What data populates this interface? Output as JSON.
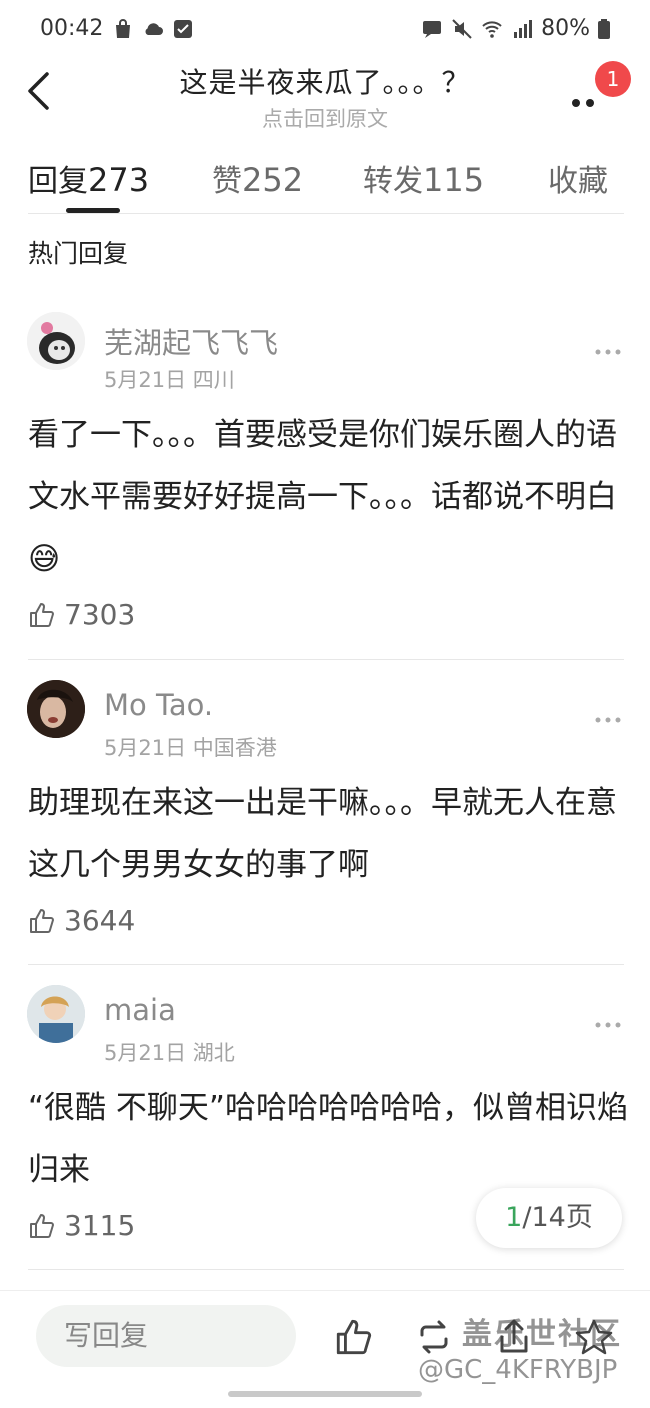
{
  "status_bar": {
    "time": "00:42",
    "battery": "80%"
  },
  "nav": {
    "title": "这是半夜来瓜了。。。？",
    "subtitle": "点击回到原文",
    "badge": "1"
  },
  "tabs": [
    {
      "label": "回复",
      "count": "273"
    },
    {
      "label": "赞",
      "count": "252"
    },
    {
      "label": "转发",
      "count": "115"
    },
    {
      "label": "收藏",
      "count": ""
    }
  ],
  "section_title": "热门回复",
  "comments": [
    {
      "name": "芜湖起飞飞飞",
      "meta": "5月21日 四川",
      "body": "看了一下。。。首要感受是你们娱乐圈人的语文水平需要好好提高一下。。。话都说不明白😅",
      "likes": "7303"
    },
    {
      "name": "Mo Tao.",
      "meta": "5月21日 中国香港",
      "body": "助理现在来这一出是干嘛。。。早就无人在意这几个男男女女的事了啊",
      "likes": "3644"
    },
    {
      "name": "maia",
      "meta": "5月21日 湖北",
      "body": "“很酷 不聊天”哈哈哈哈哈哈哈，似曾相识焰归来",
      "likes": "3115"
    }
  ],
  "pagination": {
    "current": "1",
    "total": "/14页"
  },
  "bottom_bar": {
    "reply_placeholder": "写回复"
  },
  "watermark": {
    "line1": "盖乐世社区",
    "line2": "@GC_4KFRYBJP"
  },
  "colors": {
    "accent_green": "#3aa55c",
    "badge_red": "#f0494b"
  }
}
